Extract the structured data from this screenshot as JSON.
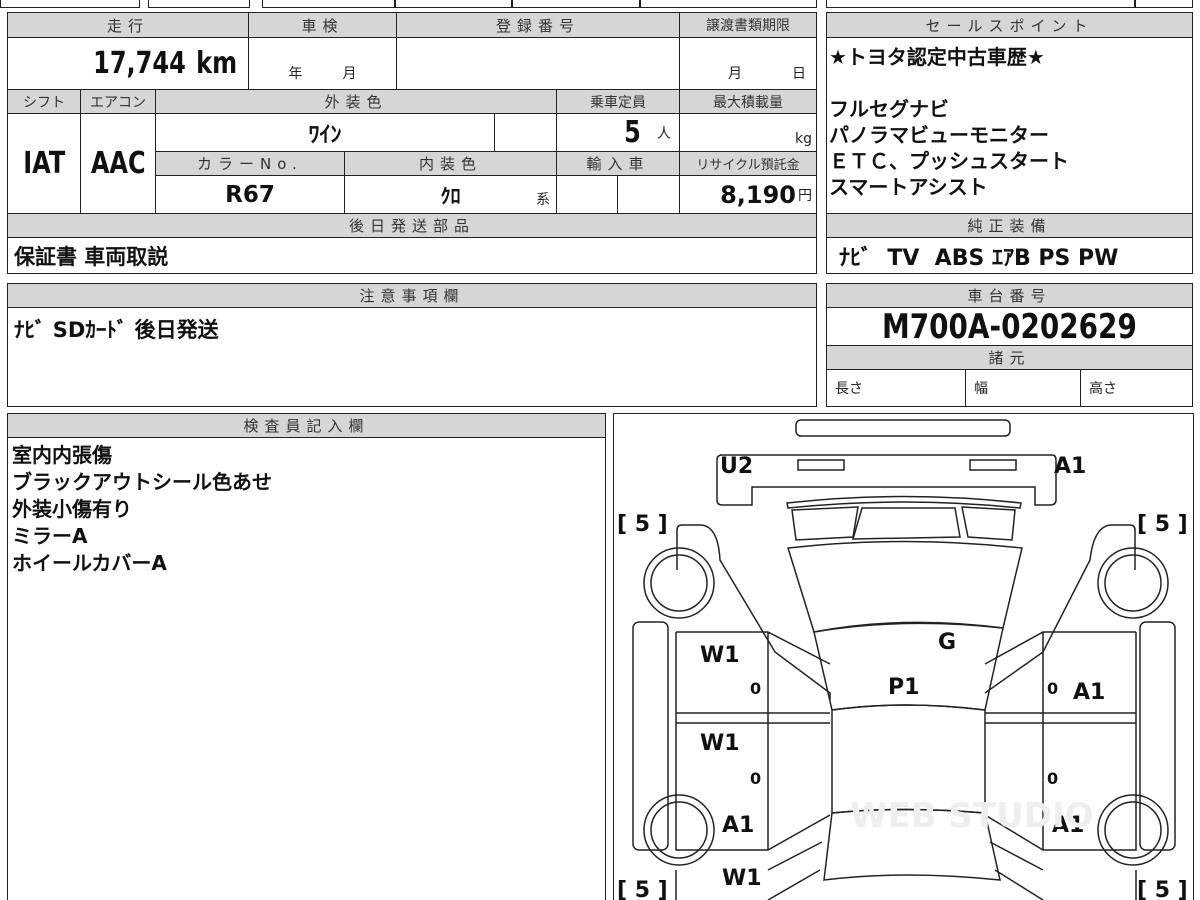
{
  "main_grid": {
    "mileage_label": "走行",
    "mileage_value": "17,744",
    "mileage_unit": "km",
    "inspection_label": "車検",
    "inspection_year": "年",
    "inspection_month": "月",
    "registration_label": "登録番号",
    "transfer_deadline_label": "譲渡書類期限",
    "transfer_month": "月",
    "transfer_day": "日",
    "shift_label": "シフト",
    "shift_value": "IAT",
    "ac_label": "エアコン",
    "ac_value": "AAC",
    "exterior_color_label": "外装色",
    "exterior_color_value": "ﾜｲﾝ",
    "capacity_label": "乗車定員",
    "capacity_value": "5",
    "capacity_unit": "人",
    "max_load_label": "最大積載量",
    "max_load_unit": "kg",
    "color_no_label": "カラーNo.",
    "color_no_value": "R67",
    "interior_color_label": "内装色",
    "interior_color_value": "ｸﾛ",
    "interior_color_suffix": "系",
    "import_label": "輸入車",
    "recycle_label": "リサイクル預託金",
    "recycle_value": "8,190",
    "recycle_unit": "円",
    "later_parts_label": "後日発送部品",
    "later_parts_value": "保証書 車両取説"
  },
  "sales_point": {
    "label": "セールスポイント",
    "lines": [
      "★トヨタ認定中古車歴★",
      "",
      "フルセグナビ",
      "パノラマビューモニター",
      "ＥＴＣ、プッシュスタート",
      "スマートアシスト"
    ],
    "equipment_label": "純正装備",
    "equipment_value": "ﾅﾋﾞ  TV  ABS ｴｱB PS PW"
  },
  "notes": {
    "label": "注意事項欄",
    "value": "ﾅﾋﾞ SDｶｰﾄﾞ 後日発送"
  },
  "chassis": {
    "label": "車台番号",
    "value": "M700A-0202629",
    "spec_label": "諸元",
    "length_label": "長さ",
    "width_label": "幅",
    "height_label": "高さ"
  },
  "inspector": {
    "label": "検査員記入欄",
    "lines": [
      "室内内張傷",
      "ブラックアウトシール色あせ",
      "外装小傷有り",
      "ミラーA",
      "ホイールカバーA"
    ]
  },
  "diagram": {
    "rear_left": "U2",
    "rear_right": "A1",
    "tire_tread": [
      "[ 5 ]",
      "[ 5 ]",
      "[ 5 ]",
      "[ 5 ]"
    ],
    "glass": "G",
    "roof": "P1",
    "left_rear_door": "W1",
    "left_front_door": "W1",
    "left_front_fender": "A1",
    "left_front_bumper_side": "W1",
    "right_rear_door": "A1",
    "right_front_fender": "A1",
    "marks": [
      "0",
      "0",
      "0",
      "0"
    ],
    "watermark": "WEB STUDIO"
  }
}
